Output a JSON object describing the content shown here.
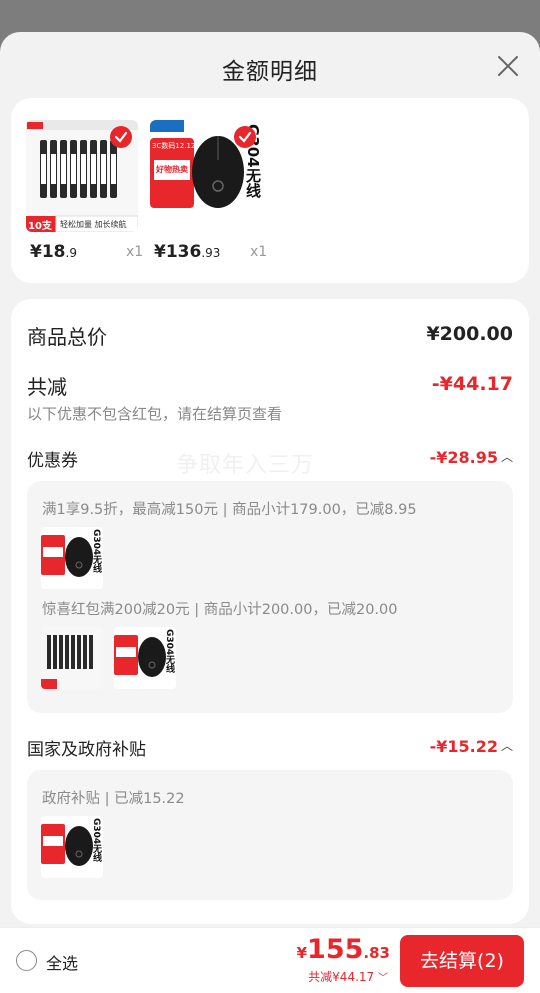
{
  "sheet": {
    "title": "金额明细"
  },
  "products": [
    {
      "price_main": "18",
      "price_dec": ".9",
      "qty": "x1",
      "box_text": "10支",
      "box_sub": "轻松加量 加长续航"
    },
    {
      "price_main": "136",
      "price_dec": ".93",
      "qty": "x1",
      "side_text": "G304无线",
      "promo": "好物热卖",
      "promo_top": "3C数码12.12"
    }
  ],
  "summary": {
    "total_label": "商品总价",
    "total_value": "¥200.00",
    "discount_label": "共减",
    "discount_value": "-¥44.17",
    "discount_note": "以下优惠不包含红包，请在结算页查看",
    "watermark": "争取年入三万"
  },
  "coupon": {
    "label": "优惠券",
    "value": "-¥28.95",
    "items": [
      {
        "text": "满1享9.5折，最高减150元 | 商品小计179.00，已减8.95"
      },
      {
        "text": "惊喜红包满200减20元 | 商品小计200.00，已减20.00"
      }
    ]
  },
  "subsidy": {
    "label": "国家及政府补贴",
    "value": "-¥15.22",
    "items": [
      {
        "text": "政府补贴 | 已减15.22"
      }
    ]
  },
  "bottom": {
    "select_all": "全选",
    "yen": "¥",
    "total_main": "155",
    "total_dec": ".83",
    "total_discount": "共减¥44.17",
    "checkout": "去结算(2)"
  },
  "colors": {
    "accent": "#e8272d",
    "muted": "#8a8a8a",
    "background": "#f2f2f2"
  },
  "icons": [
    "close-icon",
    "check-icon",
    "chevron-up-icon",
    "chevron-down-icon",
    "radio-icon"
  ]
}
